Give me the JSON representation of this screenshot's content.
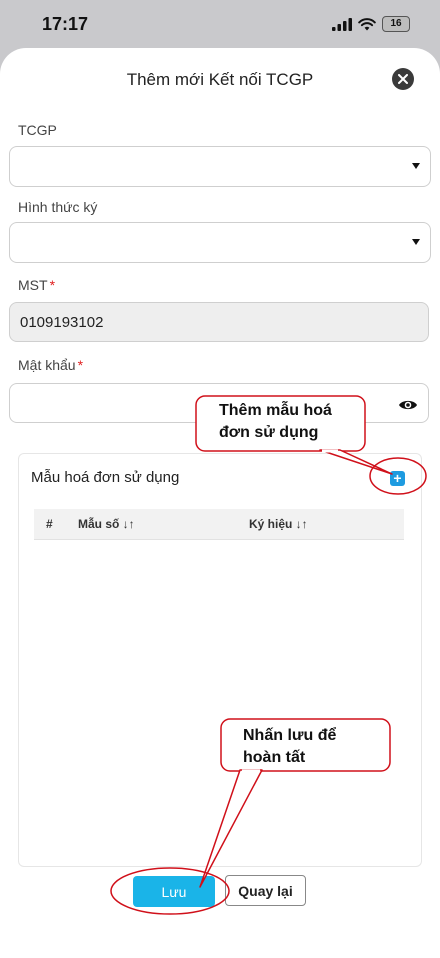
{
  "status_bar": {
    "time": "17:17",
    "battery": "16"
  },
  "modal": {
    "title": "Thêm mới Kết nối TCGP"
  },
  "form": {
    "tcgp_label": "TCGP",
    "signing_method_label": "Hình thức ký",
    "tax_code_label": "MST",
    "tax_code_value": "0109193102",
    "password_label": "Mật khẩu",
    "required_mark": "*"
  },
  "invoice_template_panel": {
    "title": "Mẫu hoá đơn sử dụng",
    "add_symbol": "+",
    "columns": [
      "#",
      "Mẫu số ↓↑",
      "Ký hiệu ↓↑"
    ]
  },
  "buttons": {
    "save": "Lưu",
    "back": "Quay lại"
  },
  "annotations": {
    "add_template_hint_line1": "Thêm mẫu hoá",
    "add_template_hint_line2": "đơn sử dụng",
    "save_hint_line1": "Nhấn lưu để",
    "save_hint_line2": "hoàn tất"
  },
  "colors": {
    "accent": "#1ab4e8",
    "add_button": "#1e9be0",
    "annotation_red": "#d0101a",
    "required": "#e02020"
  }
}
